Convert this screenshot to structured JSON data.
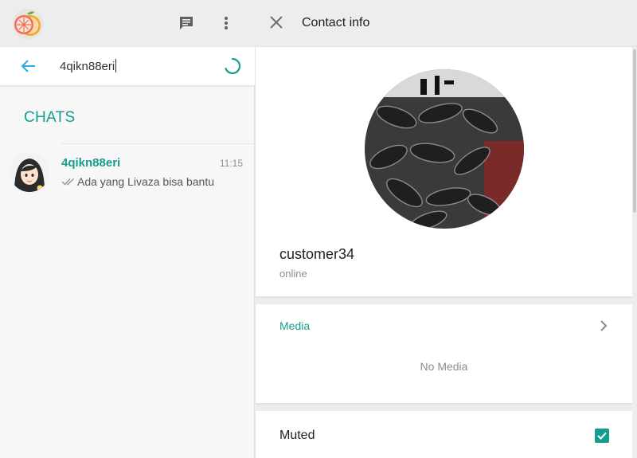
{
  "left_panel": {
    "header": {
      "app_logo_icon": "grapefruit-logo-icon",
      "new_chat_icon": "message-icon",
      "menu_icon": "more-vertical-icon"
    },
    "search": {
      "value": "4qikn88eri",
      "back_icon": "arrow-left-icon",
      "loading_icon": "spinner-icon"
    },
    "section_title": "CHATS",
    "chats": [
      {
        "name": "4qikn88eri",
        "time": "11:15",
        "preview": "Ada yang Livaza bisa bantu",
        "status_icon": "double-check-icon"
      }
    ]
  },
  "right_panel": {
    "header": {
      "title": "Contact info",
      "close_icon": "close-icon"
    },
    "profile": {
      "name": "customer34",
      "status": "online"
    },
    "media": {
      "label": "Media",
      "empty_text": "No Media"
    },
    "settings": {
      "muted_label": "Muted",
      "muted_checked": true
    }
  },
  "colors": {
    "accent": "#159e8e",
    "back_arrow": "#30a9e6",
    "header_bg": "#ededed"
  }
}
